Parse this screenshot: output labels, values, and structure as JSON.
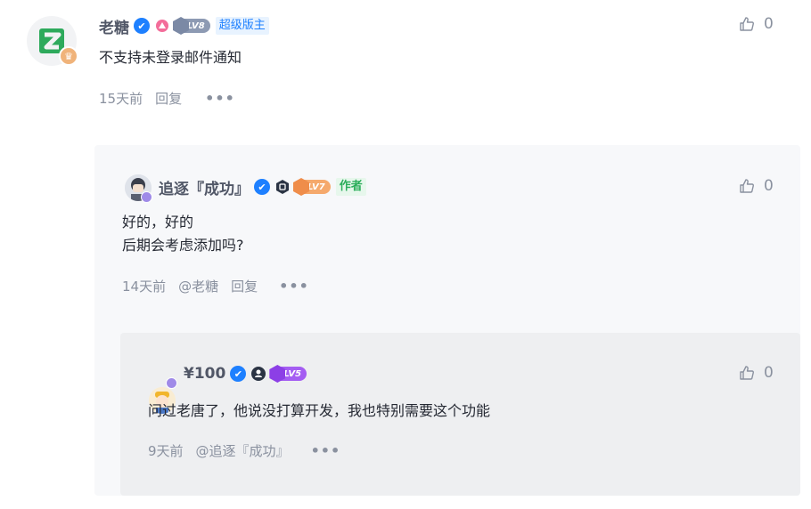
{
  "comment": {
    "username": "老糖",
    "tag": "超级版主",
    "level": "LV8",
    "content": "不支持未登录邮件通知",
    "time": "15天前",
    "reply_label": "回复",
    "likes": "0"
  },
  "reply1": {
    "username": "追逐『成功』",
    "tag": "作者",
    "level": "LV7",
    "content_lines": [
      "好的，好的",
      "后期会考虑添加吗?"
    ],
    "time": "14天前",
    "mention": "@老糖",
    "reply_label": "回复",
    "likes": "0"
  },
  "reply2": {
    "username": "¥100",
    "level": "LV5",
    "content": "问过老唐了，他说没打算开发，我也特别需要这个功能",
    "time": "9天前",
    "mention": "@追逐『成功』",
    "likes": "0"
  },
  "colors": {
    "accent": "#1e80ff",
    "lv8": "#8d9ab3",
    "lv7": "#f5a96c",
    "lv5": "#a45df2",
    "author_tag": "#2cae5b"
  }
}
